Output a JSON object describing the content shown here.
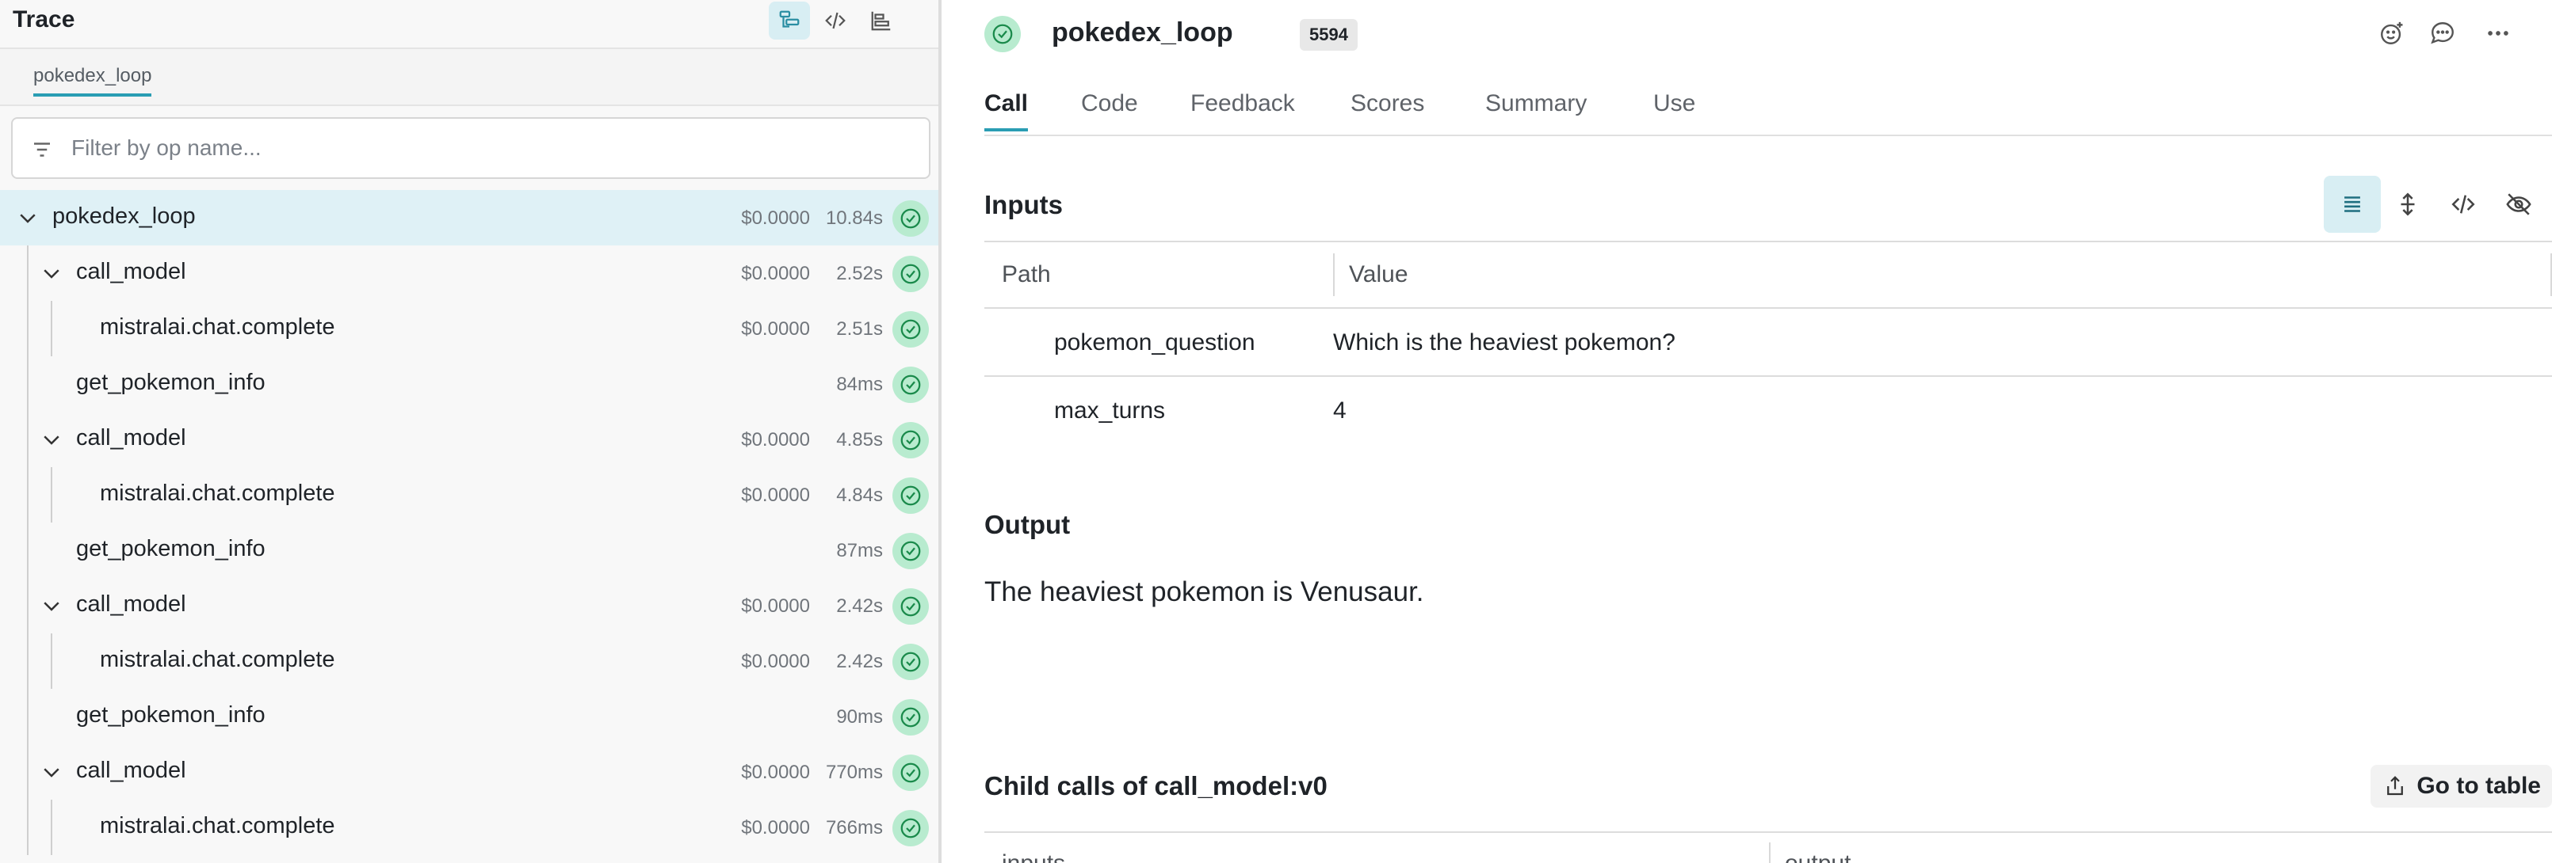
{
  "trace_panel": {
    "title": "Trace",
    "view_buttons": [
      "tree-view-icon",
      "code-view-icon",
      "timeline-view-icon"
    ],
    "breadcrumb": "pokedex_loop",
    "filter_placeholder": "Filter by op name...",
    "rows": [
      {
        "label": "pokedex_loop",
        "cost": "$0.0000",
        "duration": "10.84s",
        "expanded": true
      },
      {
        "label": "call_model",
        "cost": "$0.0000",
        "duration": "2.52s",
        "expanded": true
      },
      {
        "label": "mistralai.chat.complete",
        "cost": "$0.0000",
        "duration": "2.51s"
      },
      {
        "label": "get_pokemon_info",
        "cost": "",
        "duration": "84ms"
      },
      {
        "label": "call_model",
        "cost": "$0.0000",
        "duration": "4.85s",
        "expanded": true
      },
      {
        "label": "mistralai.chat.complete",
        "cost": "$0.0000",
        "duration": "4.84s"
      },
      {
        "label": "get_pokemon_info",
        "cost": "",
        "duration": "87ms"
      },
      {
        "label": "call_model",
        "cost": "$0.0000",
        "duration": "2.42s",
        "expanded": true
      },
      {
        "label": "mistralai.chat.complete",
        "cost": "$0.0000",
        "duration": "2.42s"
      },
      {
        "label": "get_pokemon_info",
        "cost": "",
        "duration": "90ms"
      },
      {
        "label": "call_model",
        "cost": "$0.0000",
        "duration": "770ms",
        "expanded": true
      },
      {
        "label": "mistralai.chat.complete",
        "cost": "$0.0000",
        "duration": "766ms"
      }
    ]
  },
  "call_panel": {
    "title": "pokedex_loop",
    "call_id": "5594",
    "header_icons": [
      "add-reaction-icon",
      "comment-icon",
      "more-icon"
    ],
    "tabs": [
      "Call",
      "Code",
      "Feedback",
      "Scores",
      "Summary",
      "Use"
    ],
    "active_tab": "Call",
    "inputs": {
      "title": "Inputs",
      "columns": [
        "Path",
        "Value"
      ],
      "rows": [
        {
          "path": "pokemon_question",
          "value": "Which is the heaviest pokemon?"
        },
        {
          "path": "max_turns",
          "value": "4"
        }
      ],
      "toolbar": [
        "list-view-icon",
        "expand-rows-icon",
        "code-view-icon",
        "hide-icon"
      ]
    },
    "output": {
      "title": "Output",
      "text": "The heaviest pokemon is Venusaur."
    },
    "child_calls": {
      "title": "Child calls of call_model:v0",
      "go_to_table_label": "Go to table",
      "columns": [
        "inputs",
        "output"
      ]
    }
  },
  "colors": {
    "accent": "#2a9db3",
    "selected_row": "#dff1f6",
    "status_bg": "#b8ebcf",
    "status_fg": "#1a8a4b"
  }
}
